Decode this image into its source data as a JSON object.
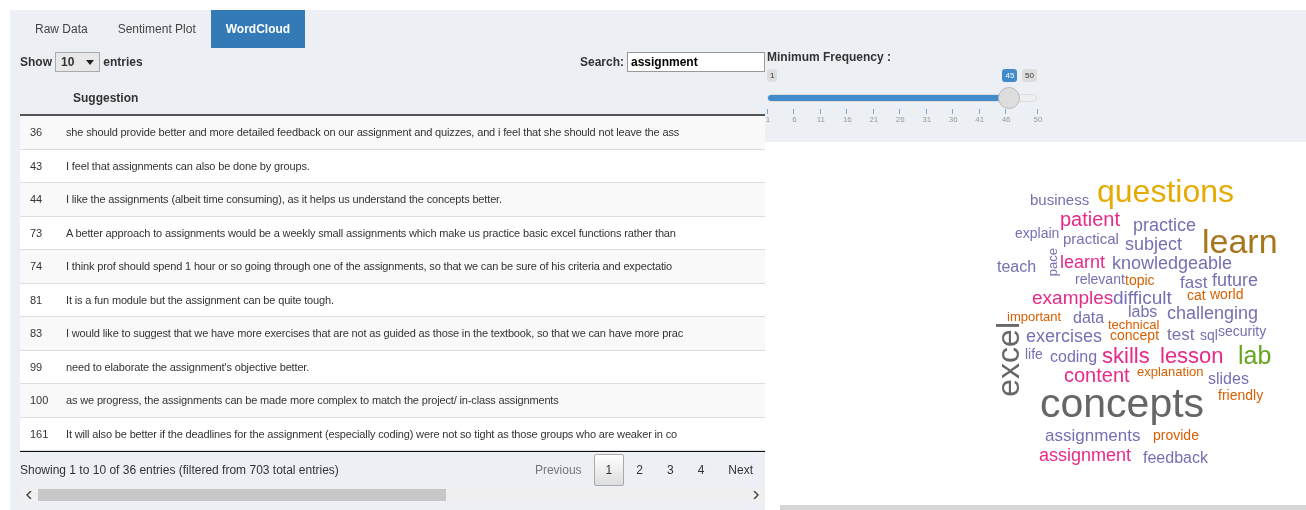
{
  "tabs": [
    {
      "label": "Raw Data",
      "selected": false
    },
    {
      "label": "Sentiment Plot",
      "selected": false
    },
    {
      "label": "WordCloud",
      "selected": true
    }
  ],
  "length_control": {
    "before": "Show",
    "value": "10",
    "after": "entries"
  },
  "search": {
    "label": "Search:",
    "value": "assignment"
  },
  "table": {
    "columns": [
      "",
      "Suggestion"
    ],
    "rows": [
      [
        "36",
        "she should provide better and more detailed feedback on our assignment and quizzes, and i feel that she should not leave the ass"
      ],
      [
        "43",
        "I feel that assignments can also be done by groups."
      ],
      [
        "44",
        "I like the assignments (albeit time consuming), as it helps us understand the concepts better."
      ],
      [
        "73",
        "A better approach to assignments would be a weekly small assignments which make us practice basic excel functions rather than"
      ],
      [
        "74",
        "I think prof should spend 1 hour or so going through one of the assignments, so that we can be sure of his criteria and expectatio"
      ],
      [
        "81",
        "It is a fun module but the assignment can be quite tough."
      ],
      [
        "83",
        "I would like to suggest that we have more exercises that are not as guided as those in the textbook, so that we can have more prac"
      ],
      [
        "99",
        "need to elaborate the assignment's objective better."
      ],
      [
        "100",
        "as we progress, the assignments can be made more complex to match the project/ in-class assignments"
      ],
      [
        "161",
        "It will also be better if the deadlines for the assignment (especially coding) were not so tight as those groups who are weaker in co"
      ]
    ]
  },
  "info": "Showing 1 to 10 of 36 entries (filtered from 703 total entries)",
  "pagination": [
    {
      "label": "Previous",
      "selected": false,
      "disabled": true
    },
    {
      "label": "1",
      "selected": true,
      "disabled": false
    },
    {
      "label": "2",
      "selected": false,
      "disabled": false
    },
    {
      "label": "3",
      "selected": false,
      "disabled": false
    },
    {
      "label": "4",
      "selected": false,
      "disabled": false
    },
    {
      "label": "Next",
      "selected": false,
      "disabled": false
    }
  ],
  "slider": {
    "label": "Minimum Frequency :",
    "min": "1",
    "max": "50",
    "value": "45",
    "level": 0.898,
    "ticks": [
      "1",
      "6",
      "11",
      "16",
      "21",
      "26",
      "31",
      "36",
      "41",
      "46",
      "50"
    ]
  },
  "wordcloud": [
    {
      "word": "business",
      "color": "#7570b3"
    },
    {
      "word": "questions",
      "color": "#e6ab02"
    },
    {
      "word": "explain",
      "color": "#7570b3"
    },
    {
      "word": "patient",
      "color": "#e7298a"
    },
    {
      "word": "practical",
      "color": "#7570b3"
    },
    {
      "word": "practice",
      "color": "#7570b3"
    },
    {
      "word": "subject",
      "color": "#7570b3"
    },
    {
      "word": "learn",
      "color": "#a6761d"
    },
    {
      "word": "teach",
      "color": "#7570b3"
    },
    {
      "word": "pace",
      "color": "#7570b3"
    },
    {
      "word": "learnt",
      "color": "#e7298a"
    },
    {
      "word": "knowledgeable",
      "color": "#7570b3"
    },
    {
      "word": "relevant",
      "color": "#7570b3"
    },
    {
      "word": "topic",
      "color": "#d95f02"
    },
    {
      "word": "fast",
      "color": "#7570b3"
    },
    {
      "word": "future",
      "color": "#7570b3"
    },
    {
      "word": "examples",
      "color": "#e7298a"
    },
    {
      "word": "difficult",
      "color": "#7570b3"
    },
    {
      "word": "cat",
      "color": "#d95f02"
    },
    {
      "word": "world",
      "color": "#d95f02"
    },
    {
      "word": "important",
      "color": "#d95f02"
    },
    {
      "word": "data",
      "color": "#7570b3"
    },
    {
      "word": "labs",
      "color": "#7570b3"
    },
    {
      "word": "technical",
      "color": "#d95f02"
    },
    {
      "word": "challenging",
      "color": "#7570b3"
    },
    {
      "word": "excel",
      "color": "#666666"
    },
    {
      "word": "exercises",
      "color": "#7570b3"
    },
    {
      "word": "concept",
      "color": "#d95f02"
    },
    {
      "word": "test",
      "color": "#7570b3"
    },
    {
      "word": "sql",
      "color": "#7570b3"
    },
    {
      "word": "security",
      "color": "#7570b3"
    },
    {
      "word": "life",
      "color": "#7570b3"
    },
    {
      "word": "coding",
      "color": "#7570b3"
    },
    {
      "word": "skills",
      "color": "#e7298a"
    },
    {
      "word": "lesson",
      "color": "#e7298a"
    },
    {
      "word": "lab",
      "color": "#66a61e"
    },
    {
      "word": "content",
      "color": "#e7298a"
    },
    {
      "word": "explanation",
      "color": "#d95f02"
    },
    {
      "word": "slides",
      "color": "#7570b3"
    },
    {
      "word": "concepts",
      "color": "#666666"
    },
    {
      "word": "friendly",
      "color": "#d95f02"
    },
    {
      "word": "assignments",
      "color": "#7570b3"
    },
    {
      "word": "provide",
      "color": "#d95f02"
    },
    {
      "word": "assignment",
      "color": "#e7298a"
    },
    {
      "word": "feedback",
      "color": "#7570b3"
    }
  ]
}
